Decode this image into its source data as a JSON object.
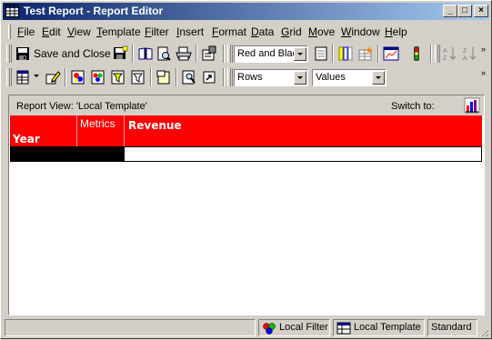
{
  "window": {
    "title": "Test Report - Report Editor",
    "controls": {
      "minimize": "_",
      "maximize": "□",
      "close": "×"
    }
  },
  "menubar": {
    "items": [
      {
        "label": "File"
      },
      {
        "label": "Edit"
      },
      {
        "label": "View"
      },
      {
        "label": "Template"
      },
      {
        "label": "Filter"
      },
      {
        "label": "Insert"
      },
      {
        "label": "Format"
      },
      {
        "label": "Data"
      },
      {
        "label": "Grid"
      },
      {
        "label": "Move"
      },
      {
        "label": "Window"
      },
      {
        "label": "Help"
      }
    ]
  },
  "toolbar1": {
    "save_close_label": "Save and Close",
    "style_combo_value": "Red and Black",
    "overflow": "»"
  },
  "toolbar2": {
    "rows_combo_value": "Rows",
    "values_combo_value": "Values",
    "overflow": "»"
  },
  "report": {
    "view_label": "Report View: 'Local Template'",
    "switch_label": "Switch to:",
    "grid": {
      "row_header": "Year",
      "column_header": "Metrics",
      "metric": "Revenue"
    },
    "colors": {
      "header_bg": "#ff0000",
      "header_text": "#ffffff",
      "row_header_fill": "#000000"
    }
  },
  "statusbar": {
    "local_filter": "Local Filter",
    "local_template": "Local Template",
    "mode": "Standard"
  }
}
